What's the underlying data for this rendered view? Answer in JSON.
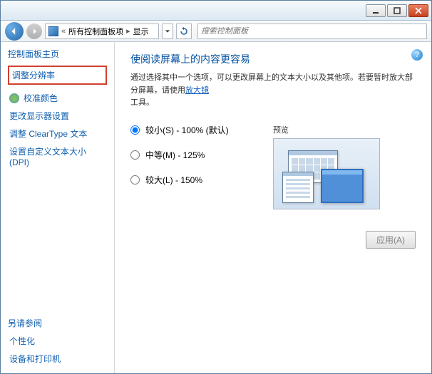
{
  "breadcrumb": {
    "part1": "所有控制面板项",
    "part2": "显示"
  },
  "search": {
    "placeholder": "搜索控制面板"
  },
  "sidebar": {
    "heading": "控制面板主页",
    "links": [
      "调整分辨率",
      "校准颜色",
      "更改显示器设置",
      "调整 ClearType 文本",
      "设置自定义文本大小(DPI)"
    ],
    "footer_heading": "另请参阅",
    "footer_links": [
      "个性化",
      "设备和打印机"
    ]
  },
  "main": {
    "title": "使阅读屏幕上的内容更容易",
    "desc_pre": "通过选择其中一个选项，可以更改屏幕上的文本大小以及其他项。若要暂时放大部分屏幕，请使用",
    "desc_link": "放大镜",
    "desc_post": "工具。",
    "options": [
      {
        "label": "较小(S) - 100% (默认)",
        "checked": true
      },
      {
        "label": "中等(M) - 125%",
        "checked": false
      },
      {
        "label": "较大(L) - 150%",
        "checked": false
      }
    ],
    "preview_label": "预览",
    "apply_label": "应用(A)",
    "help": "?"
  }
}
